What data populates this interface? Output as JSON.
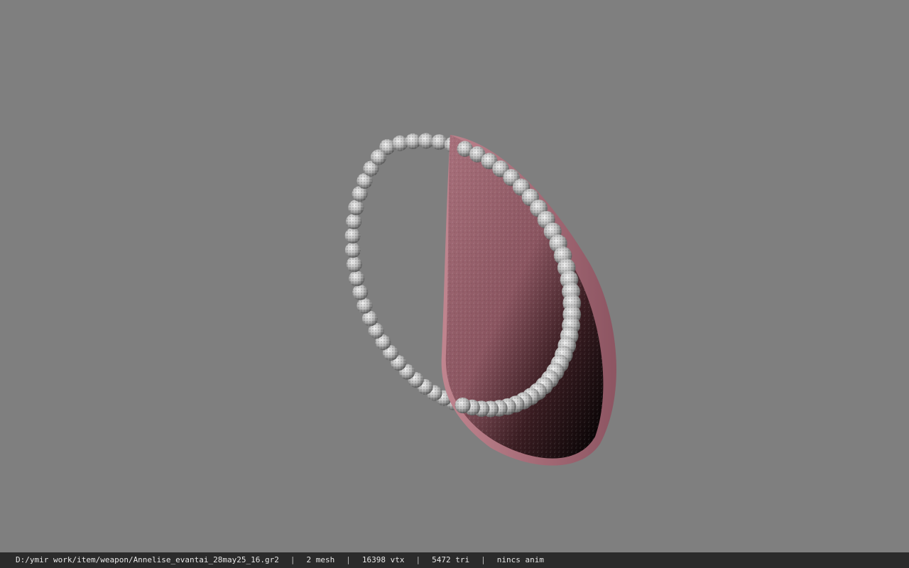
{
  "viewport": {
    "background": "#7f7f7f",
    "model": {
      "name": "pearl-fan-model",
      "accent": "#b47782",
      "bead_color": "#d8d8d8"
    }
  },
  "status": {
    "file_path": "D:/ymir work/item/weapon/Annelise_evantai_28may25_16.gr2",
    "sep": "|",
    "mesh_count": "2 mesh",
    "vtx_count": "16398 vtx",
    "tri_count": "5472 tri",
    "anim": "nincs anim"
  }
}
